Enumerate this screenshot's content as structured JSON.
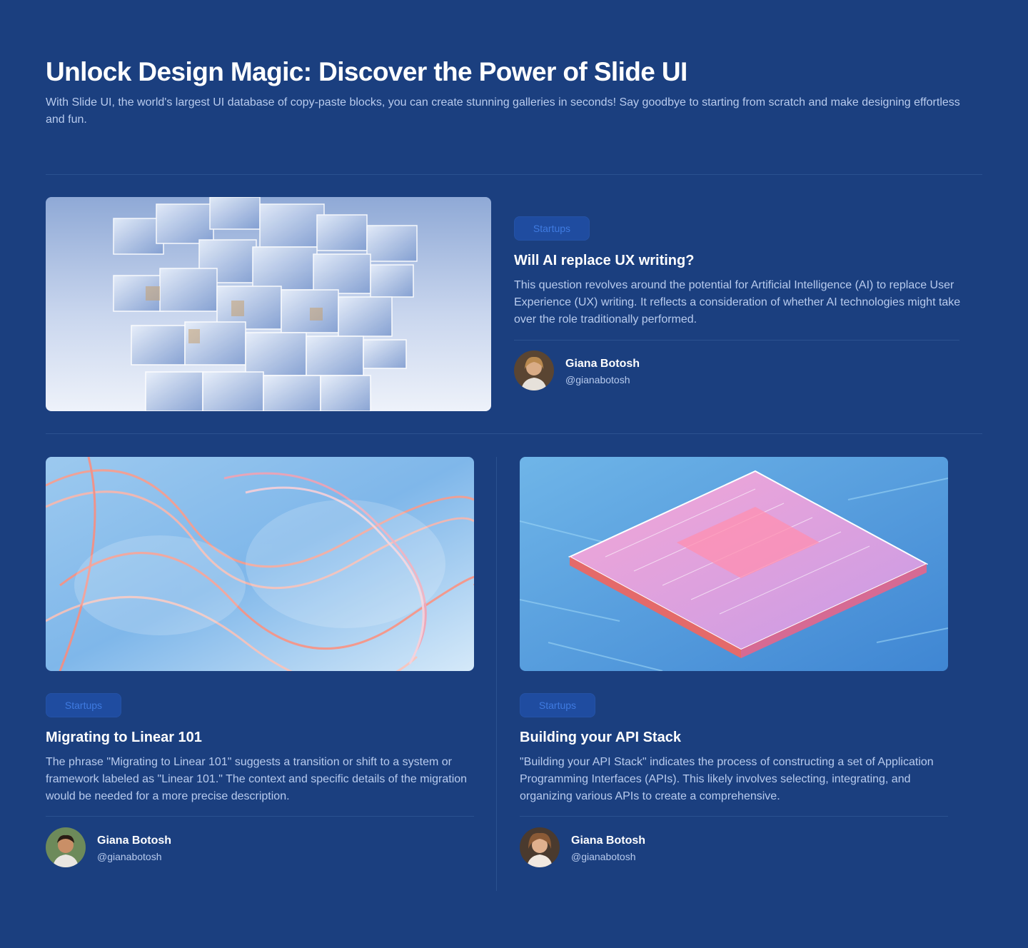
{
  "hero": {
    "title": "Unlock Design Magic: Discover the Power of Slide UI",
    "subtitle": "With Slide UI, the world's largest UI database of copy-paste blocks, you can create stunning galleries in seconds! Say goodbye to starting from scratch and make designing effortless and fun."
  },
  "posts": [
    {
      "category": "Startups",
      "title": "Will AI replace UX writing?",
      "description": "This question revolves around the potential for Artificial Intelligence (AI) to replace User Experience (UX) writing. It reflects a consideration of whether AI technologies might take over the role traditionally performed.",
      "author_name": "Giana Botosh",
      "author_handle": "@gianabotosh",
      "image": "glass-cubes-image"
    },
    {
      "category": "Startups",
      "title": "Migrating to Linear 101",
      "description": "The phrase \"Migrating to Linear 101\" suggests a transition or shift to a system or framework labeled as \"Linear 101.\" The context and specific details of the migration would be needed for a more precise description.",
      "author_name": "Giana Botosh",
      "author_handle": "@gianabotosh",
      "image": "glass-waves-image"
    },
    {
      "category": "Startups",
      "title": "Building your API Stack",
      "description": "\"Building your API Stack\" indicates the process of constructing a set of Application Programming Interfaces (APIs). This likely involves selecting, integrating, and organizing various APIs to create a comprehensive.",
      "author_name": "Giana Botosh",
      "author_handle": "@gianabotosh",
      "image": "microchip-image"
    }
  ],
  "colors": {
    "background": "#1b3f7f",
    "badge_bg": "#1f4ca0",
    "badge_text": "#3f7ae0",
    "body_text": "#b8cbee",
    "divider": "#2b5190"
  }
}
